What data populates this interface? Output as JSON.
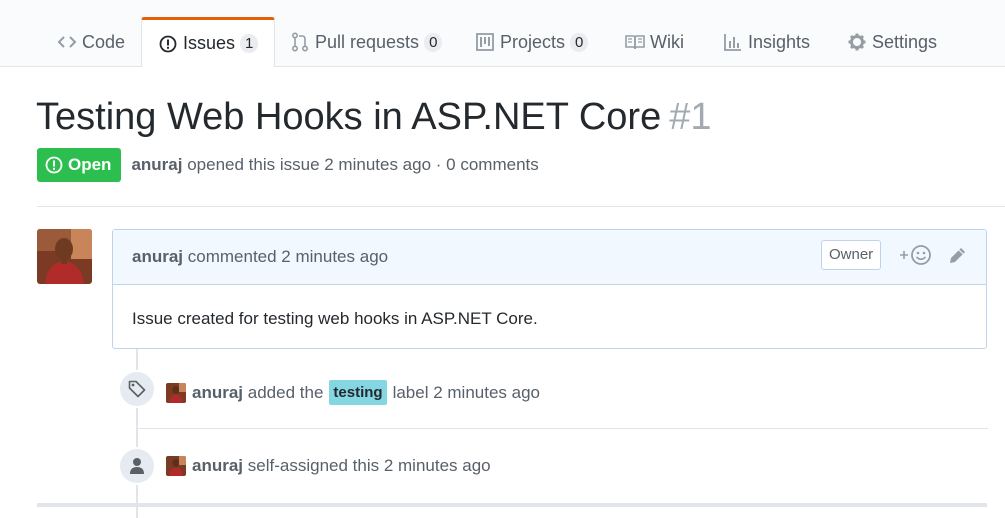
{
  "tabs": [
    {
      "label": "Code",
      "icon": "code-icon",
      "counter": null
    },
    {
      "label": "Issues",
      "icon": "issue-opened-icon",
      "counter": "1"
    },
    {
      "label": "Pull requests",
      "icon": "git-pull-request-icon",
      "counter": "0"
    },
    {
      "label": "Projects",
      "icon": "project-icon",
      "counter": "0"
    },
    {
      "label": "Wiki",
      "icon": "book-icon",
      "counter": null
    },
    {
      "label": "Insights",
      "icon": "graph-icon",
      "counter": null
    },
    {
      "label": "Settings",
      "icon": "gear-icon",
      "counter": null
    }
  ],
  "selected_tab": "Issues",
  "issue": {
    "title": "Testing Web Hooks in ASP.NET Core",
    "number": "#1",
    "state": "Open",
    "author": "anuraj",
    "opened_text": "opened this issue 2 minutes ago · 0 comments"
  },
  "comment": {
    "author": "anuraj",
    "meta": "commented 2 minutes ago",
    "role_badge": "Owner",
    "body": "Issue created for testing web hooks in ASP.NET Core."
  },
  "timeline": [
    {
      "icon": "tag-icon",
      "actor": "anuraj",
      "before": "added the",
      "label": "testing",
      "after": "label 2 minutes ago"
    },
    {
      "icon": "person-icon",
      "actor": "anuraj",
      "text": "self-assigned this 2 minutes ago"
    }
  ],
  "colors": {
    "accent_tab": "#e36209",
    "open_state": "#2cbe4e",
    "label_testing": "#84d6e3",
    "comment_header": "#f1f8ff"
  }
}
